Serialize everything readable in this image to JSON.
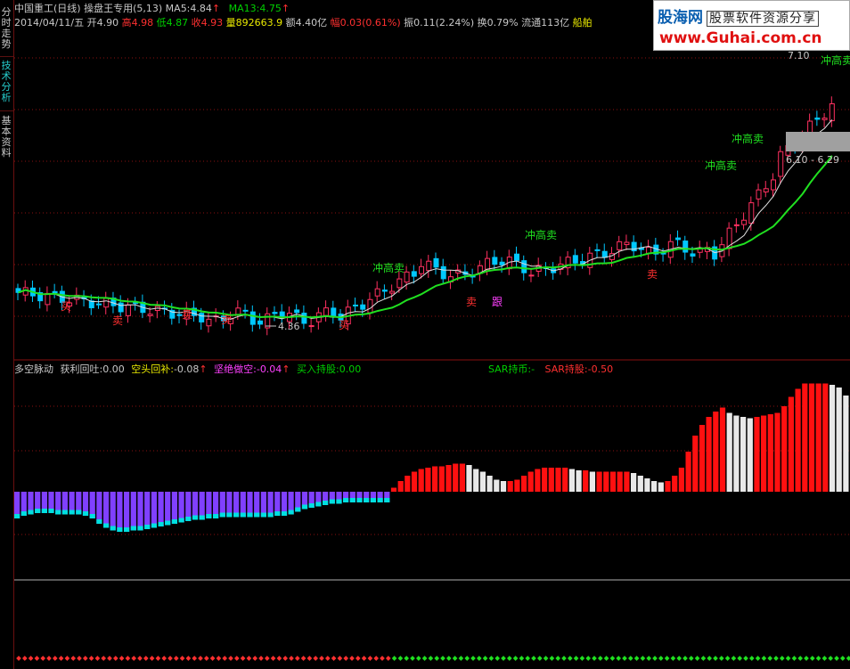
{
  "sidebar": {
    "tabs": [
      {
        "label": "分时走势",
        "active": false
      },
      {
        "label": "技术分析",
        "active": true
      },
      {
        "label": "基本资料",
        "active": false
      }
    ]
  },
  "header": {
    "line1": {
      "stock": "中国重工(日线)",
      "template": "操盘王专用",
      "params": "(5,13)",
      "ma5_label": "MA5:",
      "ma5_value": "4.84",
      "ma13_label": "MA13:",
      "ma13_value": "4.75",
      "arrow": "↑"
    },
    "line2": {
      "date": "2014/04/11/五",
      "open": "开4.90",
      "high": "高4.98",
      "low": "低4.87",
      "close": "收4.93",
      "volume": "量892663.9",
      "amount": "额4.40亿",
      "change": "幅0.03(0.61%)",
      "amplitude": "振0.11(2.24%)",
      "turnover": "换0.79%",
      "float": "流通113亿",
      "sector": "船舶"
    }
  },
  "logo": {
    "name": "股海网",
    "slogan": "股票软件资源分享",
    "url": "www.Guhai.com.cn"
  },
  "price_chart": {
    "annotations": [
      {
        "text": "买",
        "color": "#ff3030"
      },
      {
        "text": "卖",
        "color": "#ff3030"
      },
      {
        "text": "卖",
        "color": "#ff3030"
      },
      {
        "text": "卖",
        "color": "#ff3030"
      },
      {
        "text": "买",
        "color": "#ff3030"
      },
      {
        "text": "冲高卖",
        "color": "#20e020"
      },
      {
        "text": "卖",
        "color": "#ff3030"
      },
      {
        "text": "跟",
        "color": "#ff40ff"
      },
      {
        "text": "冲高卖",
        "color": "#20e020"
      },
      {
        "text": "卖",
        "color": "#ff3030"
      },
      {
        "text": "冲高卖",
        "color": "#20e020"
      },
      {
        "text": "冲高卖",
        "color": "#20e020"
      },
      {
        "text": "冲高卖",
        "color": "#20e020"
      }
    ],
    "low_label": "4.36",
    "high_label": "7.10",
    "range_label": "6.10 - 6.29"
  },
  "indicator": {
    "name": "多空脉动",
    "items": [
      {
        "label": "获利回吐:",
        "value": "0.00",
        "label_color": "#c8c8c8",
        "value_color": "#c8c8c8"
      },
      {
        "label": "空头回补:",
        "value": "-0.08",
        "label_color": "#e8e800",
        "value_color": "#c8c8c8"
      },
      {
        "label": "坚绝做空:",
        "value": "-0.04",
        "label_color": "#ff40ff",
        "value_color": "#ff40ff"
      },
      {
        "label": "买入持股:",
        "value": "0.00",
        "label_color": "#20e020",
        "value_color": "#20e020"
      }
    ],
    "sar_hold": {
      "label": "SAR持币:",
      "value": "-"
    },
    "sar_stock": {
      "label": "SAR持股:",
      "value": "-0.50"
    }
  },
  "colors": {
    "up": "#ff3060",
    "down": "#00c8ff",
    "ma_fast": "#e0e0e0",
    "ma_slow": "#20e020",
    "bar_pos": "#ff1010",
    "bar_neg": "#8040ff",
    "bar_flat": "#e8e8e8",
    "bar_edge": "#00e0e0",
    "grid": "#8a1010"
  },
  "chart_data": {
    "type": "bar",
    "title": "多空脉动",
    "xlabel": "",
    "ylabel": "",
    "series": [
      {
        "values": [
          -0.2,
          -0.18,
          -0.17,
          -0.16,
          -0.16,
          -0.16,
          -0.17,
          -0.17,
          -0.17,
          -0.17,
          -0.18,
          -0.2,
          -0.24,
          -0.27,
          -0.29,
          -0.3,
          -0.3,
          -0.29,
          -0.29,
          -0.28,
          -0.27,
          -0.26,
          -0.25,
          -0.24,
          -0.23,
          -0.22,
          -0.21,
          -0.21,
          -0.2,
          -0.2,
          -0.19,
          -0.19,
          -0.19,
          -0.19,
          -0.19,
          -0.19,
          -0.19,
          -0.19,
          -0.18,
          -0.18,
          -0.17,
          -0.15,
          -0.13,
          -0.12,
          -0.11,
          -0.1,
          -0.09,
          -0.09,
          -0.08,
          -0.08,
          -0.08,
          -0.08,
          -0.08,
          -0.08,
          -0.08,
          0.03,
          0.08,
          0.12,
          0.15,
          0.17,
          0.18,
          0.19,
          0.19,
          0.2,
          0.21,
          0.21,
          0.2,
          0.17,
          0.15,
          0.12,
          0.09,
          0.08,
          0.08,
          0.09,
          0.12,
          0.15,
          0.17,
          0.18,
          0.18,
          0.18,
          0.18,
          0.17,
          0.16,
          0.16,
          0.15,
          0.15,
          0.15,
          0.15,
          0.15,
          0.15,
          0.14,
          0.12,
          0.1,
          0.08,
          0.07,
          0.08,
          0.12,
          0.18,
          0.3,
          0.42,
          0.5,
          0.56,
          0.6,
          0.63,
          0.59,
          0.57,
          0.56,
          0.55,
          0.56,
          0.57,
          0.58,
          0.59,
          0.64,
          0.71,
          0.77,
          0.81,
          0.81,
          0.81,
          0.81,
          0.8,
          0.78,
          0.72
        ]
      }
    ]
  }
}
